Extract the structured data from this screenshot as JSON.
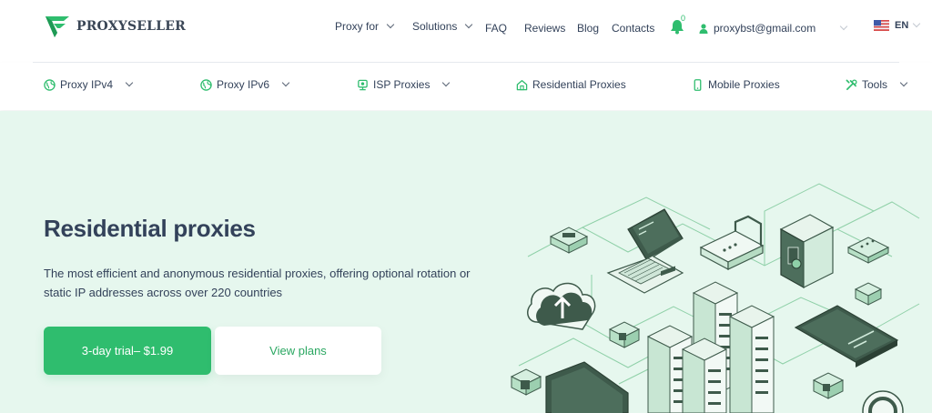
{
  "brand": {
    "name": "PROXYSELLER",
    "color": "#2fbd6e"
  },
  "topnav": {
    "proxy_for": "Proxy for",
    "solutions": "Solutions",
    "faq": "FAQ",
    "reviews": "Reviews",
    "blog": "Blog",
    "contacts": "Contacts",
    "notifications_count": "0",
    "account_email": "proxybst@gmail.com",
    "language": "EN"
  },
  "subnav": {
    "items": [
      {
        "label": "Proxy IPv4",
        "icon": "globe-icon",
        "dropdown": true
      },
      {
        "label": "Proxy IPv6",
        "icon": "globe-icon",
        "dropdown": true
      },
      {
        "label": "ISP Proxies",
        "icon": "isp-icon",
        "dropdown": true
      },
      {
        "label": "Residential Proxies",
        "icon": "home-icon",
        "dropdown": false
      },
      {
        "label": "Mobile Proxies",
        "icon": "phone-icon",
        "dropdown": false
      },
      {
        "label": "Tools",
        "icon": "tools-icon",
        "dropdown": true
      }
    ]
  },
  "hero": {
    "title": "Residential proxies",
    "description": "The most efficient and anonymous residential proxies, offering optional rotation or static IP addresses across over 220 countries",
    "trial_button": "3-day trial– $1.99",
    "plans_button": "View plans"
  },
  "colors": {
    "accent": "#2fbd6e",
    "hero_bg": "#e6f7ee",
    "text": "#33425a",
    "illustration_dark": "#3e5a4b"
  }
}
